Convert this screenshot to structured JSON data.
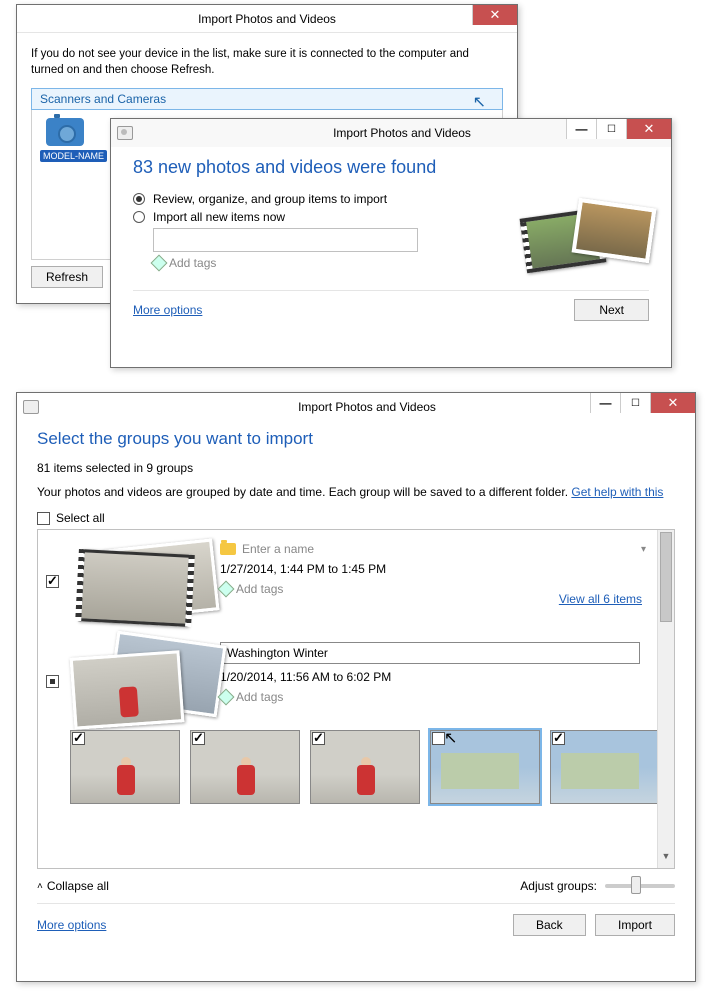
{
  "win1": {
    "title": "Import Photos and Videos",
    "instruction": "If you do not see your device in the list, make sure it is connected to the computer and turned on and then choose Refresh.",
    "section": "Scanners and Cameras",
    "device": "MODEL-NAME",
    "refresh": "Refresh"
  },
  "win2": {
    "title": "Import Photos and Videos",
    "found": "83 new photos and videos were found",
    "opt1": "Review, organize, and group items to import",
    "opt2": "Import all new items now",
    "addtags": "Add tags",
    "more": "More options",
    "next": "Next"
  },
  "win3": {
    "title": "Import Photos and Videos",
    "heading": "Select the groups you want to import",
    "selected": "81 items selected in 9 groups",
    "blurb": "Your photos and videos are grouped by date and time. Each group will be saved to a different folder. ",
    "help": "Get help with this",
    "selectall": "Select all",
    "group1": {
      "name_placeholder": "Enter a name",
      "date": "1/27/2014, 1:44 PM to 1:45 PM",
      "addtags": "Add tags",
      "viewall": "View all 6 items"
    },
    "group2": {
      "name": "Washington Winter",
      "date": "1/20/2014, 11:56 AM to 6:02 PM",
      "addtags": "Add tags"
    },
    "collapse": "Collapse all",
    "adjust": "Adjust groups:",
    "more": "More options",
    "back": "Back",
    "import": "Import"
  }
}
